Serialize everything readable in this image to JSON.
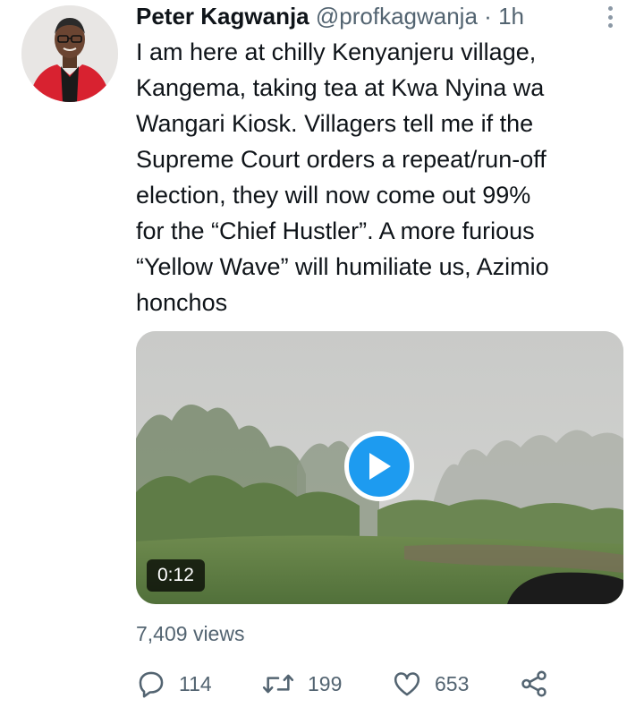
{
  "tweet": {
    "author_name": "Peter Kagwanja",
    "handle": "@profkagwanja",
    "separator": "·",
    "timestamp": "1h",
    "text": "I am here at chilly Kenyanjeru village,\nKangema, taking tea at Kwa Nyina wa\nWangari Kiosk. Villagers tell me if the\nSupreme Court orders a repeat/run-off\nelection, they will now come out 99%\nfor the “Chief Hustler”. A more furious\n“Yellow Wave” will humiliate us, Azimio\nhonchos",
    "media": {
      "type": "video",
      "duration": "0:12",
      "play_icon": "play-icon"
    },
    "views": "7,409 views",
    "actions": {
      "replies": "114",
      "retweets": "199",
      "likes": "653"
    }
  },
  "colors": {
    "accent": "#1d9bf0",
    "secondary_text": "#536471",
    "primary_text": "#0f1419"
  },
  "icons": [
    "reply-icon",
    "retweet-icon",
    "like-icon",
    "share-icon",
    "more-icon"
  ]
}
